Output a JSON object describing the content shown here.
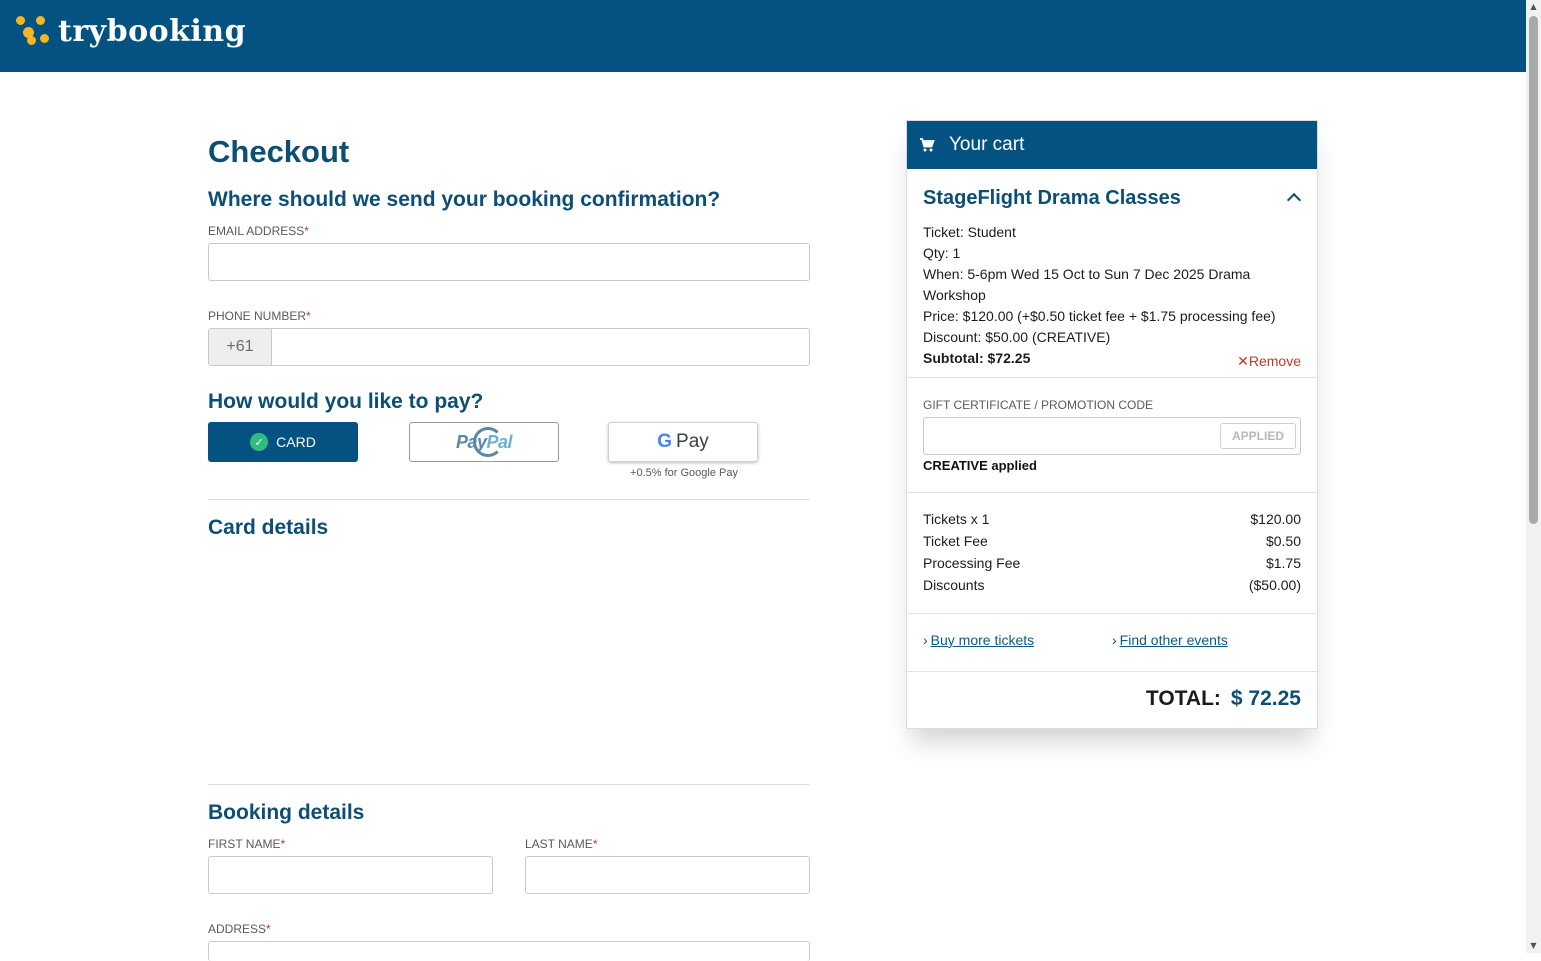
{
  "header": {
    "brand": "trybooking"
  },
  "checkout": {
    "title": "Checkout",
    "confirm_heading": "Where should we send your booking confirmation?",
    "email_label": "EMAIL ADDRESS",
    "email_value": "",
    "phone_label": "PHONE NUMBER",
    "phone_prefix": "+61",
    "phone_value": "",
    "required_mark": "*",
    "pay_heading": "How would you like to pay?",
    "pay_options": {
      "card": "CARD",
      "paypal_a": "Pay",
      "paypal_b": "Pal",
      "gpay_g": "G",
      "gpay_pay": "Pay",
      "gpay_note": "+0.5% for Google Pay"
    },
    "card_details_heading": "Card details",
    "booking_heading": "Booking details",
    "first_name_label": "FIRST NAME",
    "last_name_label": "LAST NAME",
    "address_label": "ADDRESS"
  },
  "cart": {
    "title": "Your cart",
    "event_title": "StageFlight Drama Classes",
    "ticket": "Ticket: Student",
    "qty": "Qty: 1",
    "when": "When: 5-6pm Wed 15 Oct to Sun 7 Dec 2025 Drama Workshop",
    "price": "Price: $120.00 (+$0.50 ticket fee + $1.75 processing fee)",
    "discount": "Discount: $50.00 (CREATIVE)",
    "subtotal": "Subtotal: $72.25",
    "remove": "Remove",
    "promo_label": "GIFT CERTIFICATE / PROMOTION CODE",
    "promo_value": "",
    "applied_button": "APPLIED",
    "applied_text": "CREATIVE applied",
    "lines": [
      {
        "label": "Tickets x 1",
        "value": "$120.00"
      },
      {
        "label": "Ticket Fee",
        "value": "$0.50"
      },
      {
        "label": "Processing Fee",
        "value": "$1.75"
      },
      {
        "label": "Discounts",
        "value": "($50.00)"
      }
    ],
    "buy_more": "Buy more tickets",
    "find_events": "Find other events",
    "total_label": "TOTAL:",
    "total_value": "$ 72.25"
  },
  "colors": {
    "brand": "#045282",
    "heading": "#0c4e74",
    "accent": "#f5b621",
    "danger": "#c0392b",
    "success": "#2fbd84"
  }
}
